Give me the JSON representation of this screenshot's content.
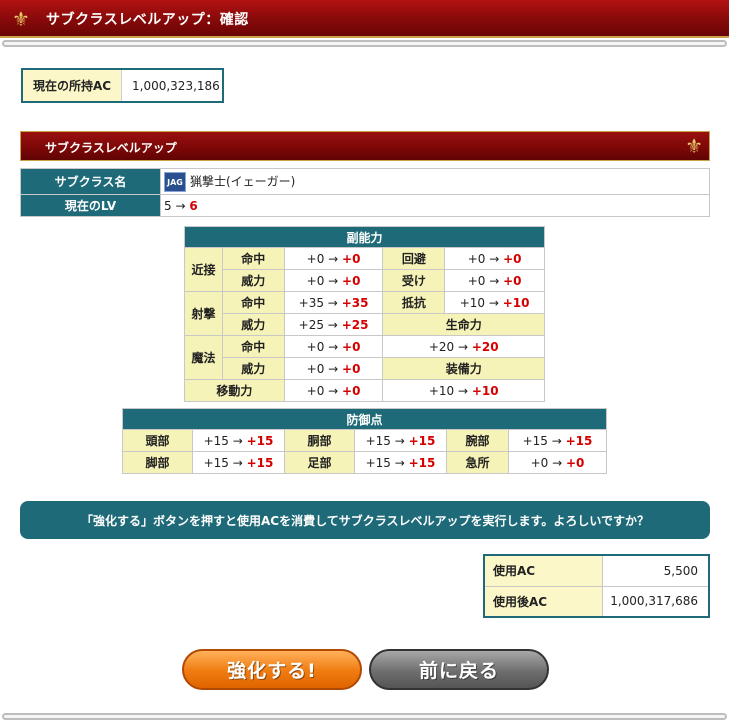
{
  "header": {
    "title": "サブクラスレベルアップ：確認",
    "ornament": "⚜"
  },
  "ac": {
    "label": "現在の所持AC",
    "value": "1,000,323,186"
  },
  "section": {
    "title": "サブクラスレベルアップ",
    "ornament": "⚜"
  },
  "subclass": {
    "name_label": "サブクラス名",
    "badge": "JAG",
    "name": "猟撃士(イェーガー)",
    "lv_label": "現在のLV",
    "lv_from": "5 → ",
    "lv_to": "6"
  },
  "stats": {
    "title": "副能力",
    "groups": {
      "melee": "近接",
      "ranged": "射撃",
      "magic": "魔法"
    },
    "rows": {
      "melee_hit": {
        "label": "命中",
        "from": "+0 → ",
        "to": "+0"
      },
      "evade": {
        "label": "回避",
        "from": "+0 → ",
        "to": "+0"
      },
      "melee_pow": {
        "label": "威力",
        "from": "+0 → ",
        "to": "+0"
      },
      "guard": {
        "label": "受け",
        "from": "+0 → ",
        "to": "+0"
      },
      "ranged_hit": {
        "label": "命中",
        "from": "+35 → ",
        "to": "+35"
      },
      "resist": {
        "label": "抵抗",
        "from": "+10 → ",
        "to": "+10"
      },
      "ranged_pow": {
        "label": "威力",
        "from": "+25 → ",
        "to": "+25"
      },
      "life_label": "生命力",
      "magic_hit": {
        "label": "命中",
        "from": "+0 → ",
        "to": "+0"
      },
      "life": {
        "from": "+20 → ",
        "to": "+20"
      },
      "magic_pow": {
        "label": "威力",
        "from": "+0 → ",
        "to": "+0"
      },
      "equip_label": "装備力",
      "move": {
        "label": "移動力",
        "from": "+0 → ",
        "to": "+0"
      },
      "equip": {
        "from": "+10 → ",
        "to": "+10"
      }
    }
  },
  "defense": {
    "title": "防御点",
    "head": {
      "label": "頭部",
      "from": "+15 → ",
      "to": "+15"
    },
    "body": {
      "label": "胴部",
      "from": "+15 → ",
      "to": "+15"
    },
    "arm": {
      "label": "腕部",
      "from": "+15 → ",
      "to": "+15"
    },
    "leg": {
      "label": "脚部",
      "from": "+15 → ",
      "to": "+15"
    },
    "foot": {
      "label": "足部",
      "from": "+15 → ",
      "to": "+15"
    },
    "vital": {
      "label": "急所",
      "from": "+0 → ",
      "to": "+0"
    }
  },
  "message": "「強化する」ボタンを押すと使用ACを消費してサブクラスレベルアップを実行します。よろしいですか？",
  "cost": {
    "use_label": "使用AC",
    "use_value": "5,500",
    "after_label": "使用後AC",
    "after_value": "1,000,317,686"
  },
  "buttons": {
    "confirm": "強化する!",
    "back": "前に戻る"
  },
  "colors": {
    "teal": "#1e6a78",
    "red_header": "#8a0a0a",
    "highlight": "#d40000",
    "label_bg": "#f6f3b8"
  }
}
